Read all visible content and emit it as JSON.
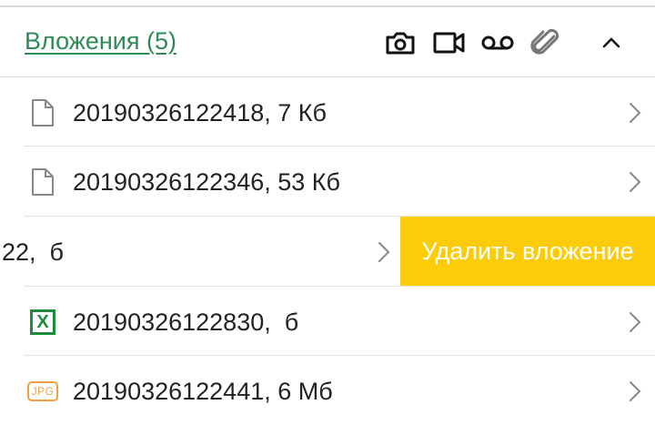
{
  "header": {
    "title": "Вложения (5)",
    "icons": [
      "camera-icon",
      "video-icon",
      "voicemail-icon",
      "paperclip-icon",
      "chevron-up-icon"
    ],
    "title_color": "#2e8b57"
  },
  "attachments": [
    {
      "name": "20190326122418, 7 Кб",
      "icon": "file-icon"
    },
    {
      "name": "20190326122346, 53 Кб",
      "icon": "file-icon"
    },
    {
      "name": "22,  б",
      "icon": "",
      "swiped": true
    },
    {
      "name": "20190326122830,  б",
      "icon": "excel-icon",
      "icon_text": "X"
    },
    {
      "name": "20190326122441, 6 Мб",
      "icon": "jpg-icon",
      "icon_text": "JPG"
    }
  ],
  "swipe_action": {
    "label": "Удалить вложение",
    "color": "#fccc0a"
  }
}
